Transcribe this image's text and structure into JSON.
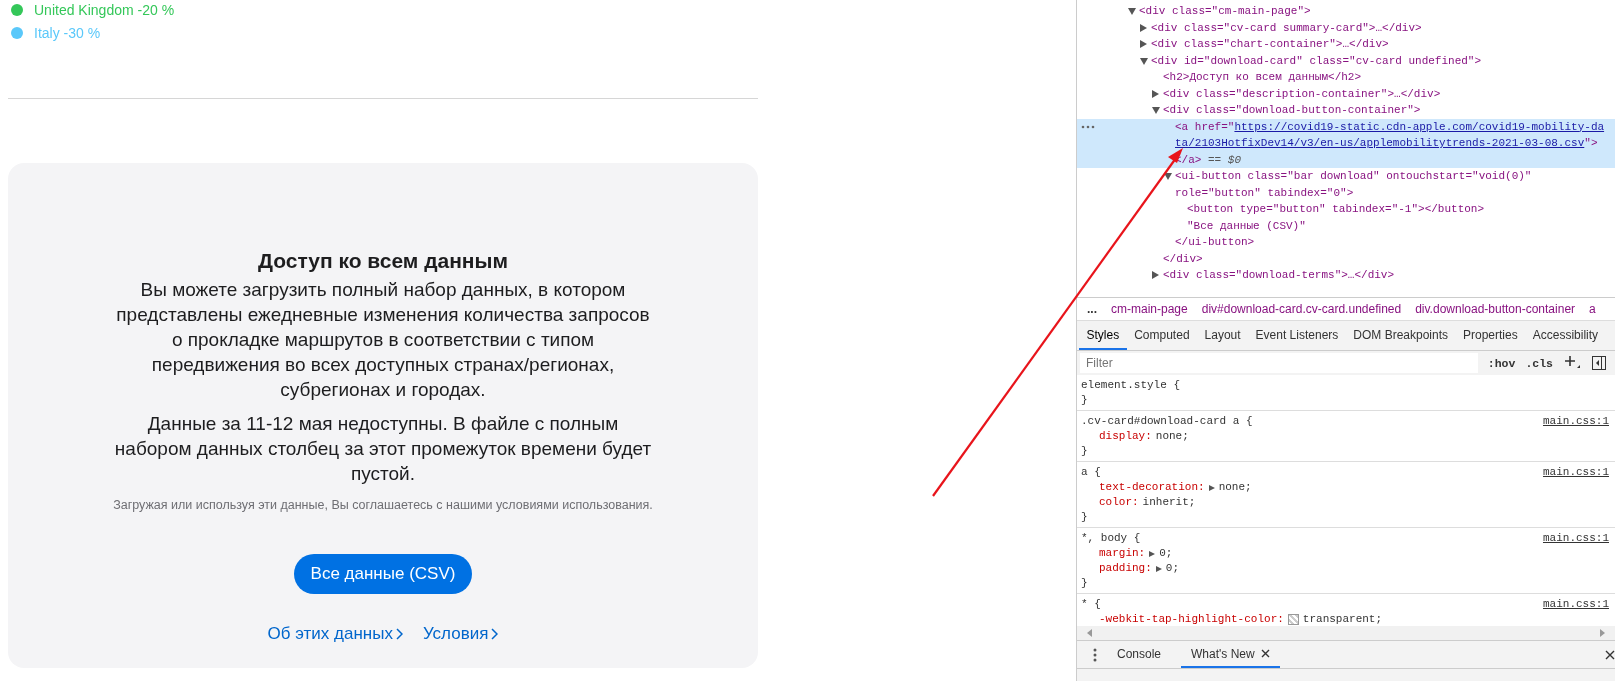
{
  "legend": [
    {
      "label": "United Kingdom -20 %",
      "color": "#34c759"
    },
    {
      "label": "Italy -30 %",
      "color": "#5ac8fa"
    }
  ],
  "download_card": {
    "title": "Доступ ко всем данным",
    "paragraphs": [
      "Вы можете загрузить полный набор данных, в котором представлены ежедневные изменения количества запросов о прокладке маршрутов в соответствии с типом передвижения во всех доступных странах/регионах, субрегионах и городах.",
      "Данные за 11-12 мая недоступны. В файле с полным набором данных столбец за этот промежуток времени будет пустой."
    ],
    "note": "Загружая или используя эти данные, Вы соглашаетесь с нашими условиями использования.",
    "button": "Все данные (CSV)",
    "links": [
      "Об этих данных",
      "Условия"
    ]
  },
  "devtools": {
    "elements_tree": [
      {
        "text": "<div class=\"cm-main-page\">",
        "expanded": true,
        "selected": false,
        "children": [
          {
            "text": "<div class=\"cv-card summary-card\">…</div>",
            "expanded": false,
            "selected": false
          },
          {
            "text": "<div class=\"chart-container\">…</div>",
            "expanded": false,
            "selected": false
          },
          {
            "text": "<div id=\"download-card\" class=\"cv-card undefined\">",
            "expanded": true,
            "selected": false,
            "children": [
              {
                "text": "<h2>Доступ ко всем данным</h2>",
                "selected": false
              },
              {
                "text": "<div class=\"description-container\">…</div>",
                "expanded": false,
                "selected": false
              },
              {
                "text": "<div class=\"download-button-container\">",
                "expanded": true,
                "selected": false,
                "closing": "</div>",
                "children": [
                  {
                    "kind": "link",
                    "text": "<a href=\"",
                    "href": "https://covid19-static.cdn-apple.com/covid19-mobility-data/2103HotfixDev14/v3/en-us/applemobilitytrends-2021-03-08.csv",
                    "tail": "\"></a>",
                    "marker": "== $0",
                    "selected": true
                  },
                  {
                    "text": "<ui-button class=\"bar download\" ontouchstart=\"void(0)\" role=\"button\" tabindex=\"0\">",
                    "expanded": true,
                    "selected": false,
                    "closing": "</ui-button>",
                    "children": [
                      {
                        "text": "<button type=\"button\" tabindex=\"-1\"></button>",
                        "selected": false
                      },
                      {
                        "text": "\"Все данные (CSV)\"",
                        "selected": false
                      }
                    ]
                  }
                ]
              },
              {
                "text": "<div class=\"download-terms\">…</div>",
                "expanded": false,
                "selected": false
              }
            ]
          }
        ]
      }
    ],
    "breadcrumb_more": "...",
    "breadcrumbs": [
      "cm-main-page",
      "div#download-card.cv-card.undefined",
      "div.download-button-container",
      "a"
    ],
    "tabs": [
      {
        "label": "Styles",
        "selected": true
      },
      {
        "label": "Computed",
        "selected": false
      },
      {
        "label": "Layout",
        "selected": false
      },
      {
        "label": "Event Listeners",
        "selected": false
      },
      {
        "label": "DOM Breakpoints",
        "selected": false
      },
      {
        "label": "Properties",
        "selected": false
      },
      {
        "label": "Accessibility",
        "selected": false
      }
    ],
    "filter": {
      "placeholder": "Filter"
    },
    "filter_buttons": [
      ":hov",
      ".cls"
    ],
    "rules": [
      {
        "selector": "element.style {",
        "closing": "}"
      },
      {
        "selector": ".cv-card#download-card a {",
        "source": "main.css:1",
        "closing": "}",
        "declarations": [
          {
            "name": "display:",
            "value": "none;"
          }
        ]
      },
      {
        "selector": "a {",
        "source": "main.css:1",
        "closing": "}",
        "declarations": [
          {
            "name": "text-decoration:",
            "value": "none;",
            "expandable": true
          },
          {
            "name": "color:",
            "value": "inherit;"
          }
        ]
      },
      {
        "selector": "*, body {",
        "source": "main.css:1",
        "closing": "}",
        "declarations": [
          {
            "name": "margin:",
            "value": "0;",
            "expandable": true
          },
          {
            "name": "padding:",
            "value": "0;",
            "expandable": true
          }
        ]
      },
      {
        "selector": "* {",
        "source": "main.css:1",
        "declarations": [
          {
            "name": "-webkit-tap-highlight-color:",
            "value": "transparent;",
            "swatch": true
          }
        ]
      }
    ],
    "drawer_tabs": [
      {
        "label": "Console",
        "selected": false,
        "closable": false
      },
      {
        "label": "What's New",
        "selected": true,
        "closable": true
      }
    ]
  }
}
